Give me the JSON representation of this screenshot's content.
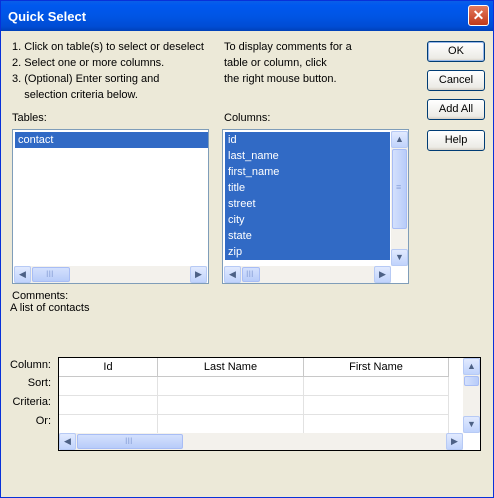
{
  "window": {
    "title": "Quick Select"
  },
  "instructions": {
    "left": [
      "1. Click on table(s) to select or deselect",
      "2. Select one or more columns.",
      "3. (Optional) Enter sorting and",
      "    selection criteria below."
    ],
    "right": [
      "To display comments for a",
      "table or column, click",
      "the right mouse button."
    ]
  },
  "buttons": {
    "ok": "OK",
    "cancel": "Cancel",
    "add_all": "Add All",
    "help": "Help"
  },
  "tables": {
    "label": "Tables:",
    "items": [
      "contact"
    ]
  },
  "columns": {
    "label": "Columns:",
    "items": [
      "id",
      "last_name",
      "first_name",
      "title",
      "street",
      "city",
      "state",
      "zip"
    ]
  },
  "comments": {
    "label": "Comments:",
    "text": "A list of contacts"
  },
  "criteria_grid": {
    "row_labels": [
      "Column:",
      "Sort:",
      "Criteria:",
      "Or:"
    ],
    "headers": [
      "Id",
      "Last Name",
      "First Name"
    ]
  },
  "icons": {
    "close": "close-icon",
    "up": "scroll-up-arrow-icon",
    "down": "scroll-down-arrow-icon",
    "left": "scroll-left-arrow-icon",
    "right": "scroll-right-arrow-icon"
  }
}
